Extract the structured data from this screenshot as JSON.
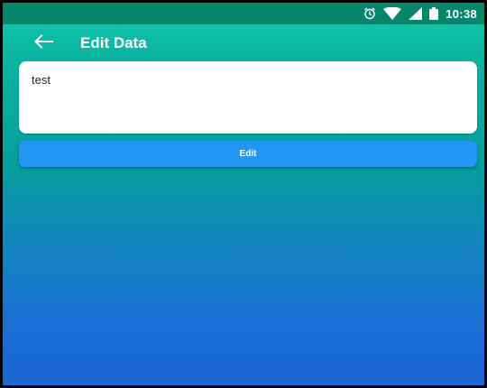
{
  "status_bar": {
    "time": "10:38",
    "icons": [
      "alarm-icon",
      "wifi-icon",
      "signal-icon",
      "battery-icon"
    ]
  },
  "app_bar": {
    "back_icon": "back-arrow-icon",
    "title": "Edit Data"
  },
  "form": {
    "text_value": "test",
    "edit_label": "Edit"
  },
  "colors": {
    "status_bar": "#06866b",
    "gradient_top": "#13c9a9",
    "gradient_bottom": "#1b66d2",
    "button": "#2196f3"
  }
}
